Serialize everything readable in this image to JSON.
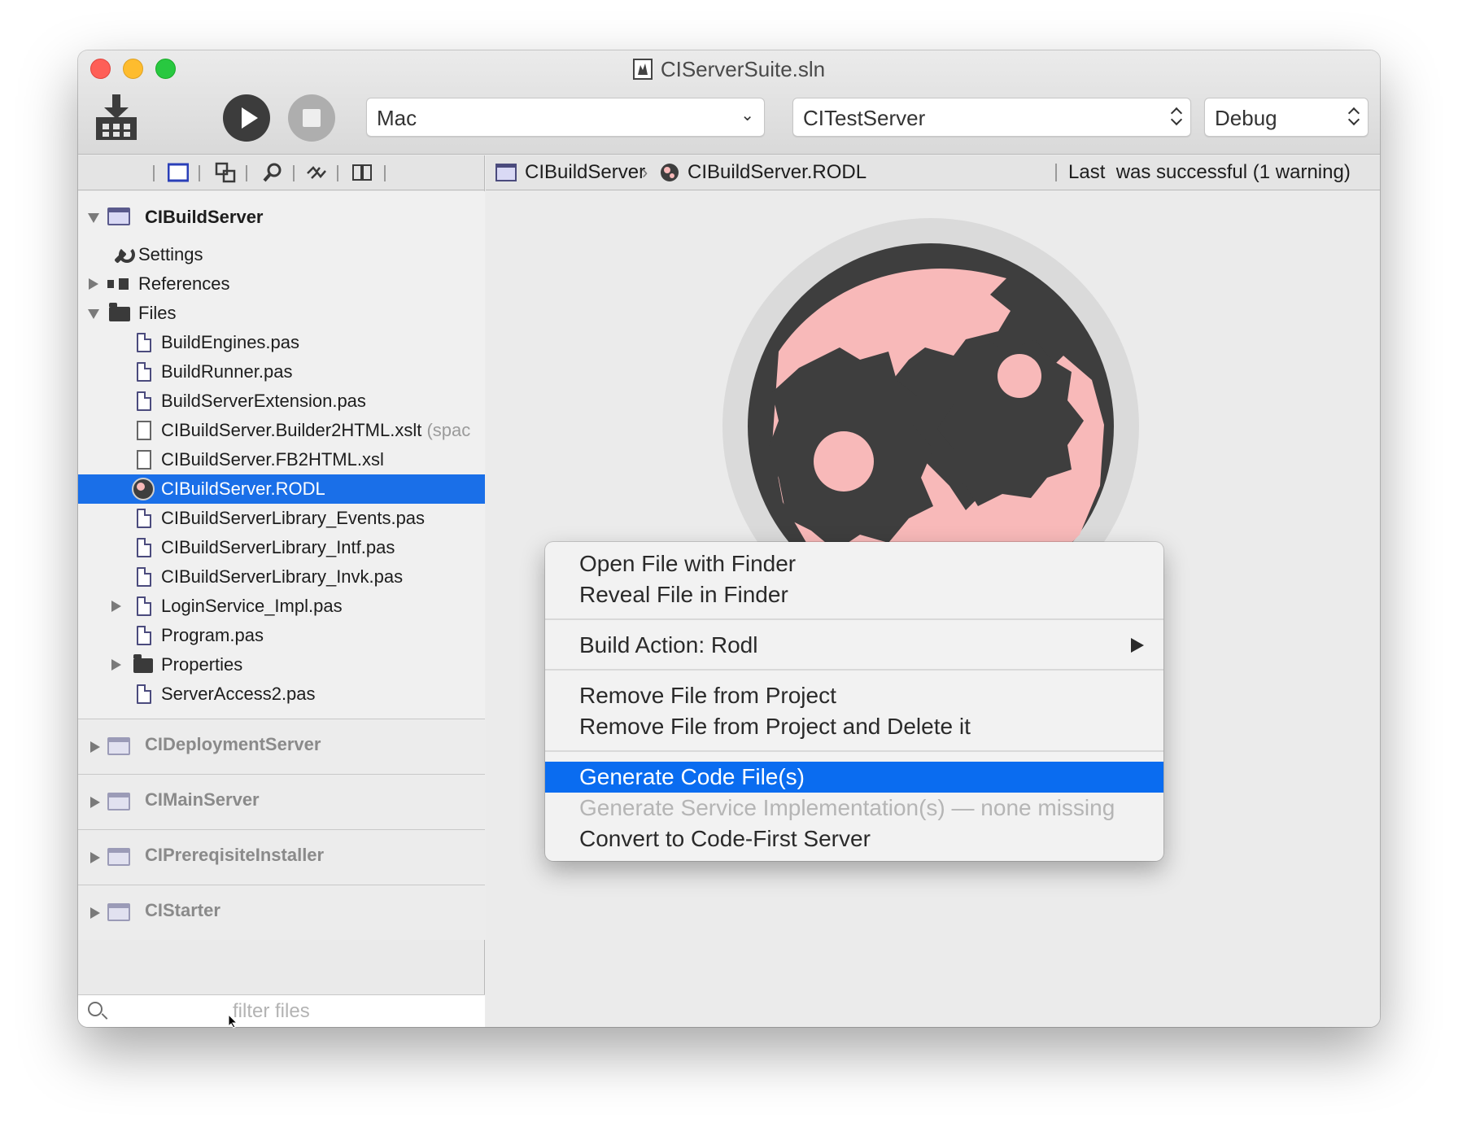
{
  "window": {
    "title": "CIServerSuite.sln"
  },
  "toolbar": {
    "platform": "Mac",
    "target": "CITestServer",
    "configuration": "Debug"
  },
  "navigator": {
    "project": "CIBuildServer",
    "items": [
      {
        "label": "Settings"
      },
      {
        "label": "References"
      },
      {
        "label": "Files"
      },
      {
        "label": "BuildEngines.pas"
      },
      {
        "label": "BuildRunner.pas"
      },
      {
        "label": "BuildServerExtension.pas"
      },
      {
        "label": "CIBuildServer.Builder2HTML.xslt",
        "note": "(spac"
      },
      {
        "label": "CIBuildServer.FB2HTML.xsl"
      },
      {
        "label": "CIBuildServer.RODL"
      },
      {
        "label": "CIBuildServerLibrary_Events.pas"
      },
      {
        "label": "CIBuildServerLibrary_Intf.pas"
      },
      {
        "label": "CIBuildServerLibrary_Invk.pas"
      },
      {
        "label": "LoginService_Impl.pas"
      },
      {
        "label": "Program.pas"
      },
      {
        "label": "Properties"
      },
      {
        "label": "ServerAccess2.pas"
      }
    ],
    "groups": [
      "CIDeploymentServer",
      "CIMainServer",
      "CIPrereqisiteInstaller",
      "CIStarter"
    ],
    "filter_placeholder": "filter files"
  },
  "pathbar": {
    "crumb1": "CIBuildServer",
    "crumb2": "CIBuildServer.RODL",
    "status": "Last  was successful (1 warning)"
  },
  "context_menu": {
    "items": [
      "Open File with Finder",
      "Reveal File in Finder",
      "Build Action: Rodl",
      "Remove File from Project",
      "Remove File from Project and Delete it",
      "Generate Code File(s)",
      "Generate Service Implementation(s) — none missing",
      "Convert to Code-First Server"
    ]
  },
  "colors": {
    "selection": "#1a6fe8",
    "menu_highlight": "#0a6cf0",
    "rodl_dark": "#3e3e3e",
    "rodl_pink": "#f8b9b9"
  }
}
